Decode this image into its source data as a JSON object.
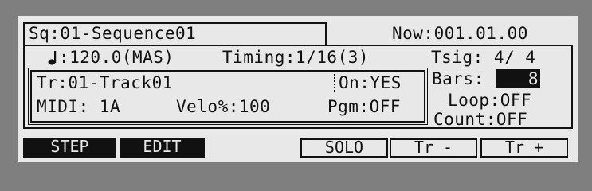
{
  "header": {
    "sequence": "Sq:01-Sequence01",
    "now": "Now:001.01.00"
  },
  "status": {
    "tempo_icon": "note-icon",
    "tempo": ":120.0(MAS)",
    "timing": "Timing:1/16(3)",
    "tsig": "Tsig: 4/ 4"
  },
  "track": {
    "name": "Tr:01-Track01",
    "on": "On:YES",
    "midi": "MIDI: 1A",
    "velo": "Velo%:100",
    "pgm": "Pgm:OFF"
  },
  "settings": {
    "bars_label": "Bars:",
    "bars_value": "8",
    "loop": "Loop:OFF",
    "count": "Count:OFF"
  },
  "softkeys": {
    "step": "STEP",
    "edit": "EDIT",
    "solo": "SOLO",
    "tr_minus": "Tr -",
    "tr_plus": "Tr +"
  }
}
